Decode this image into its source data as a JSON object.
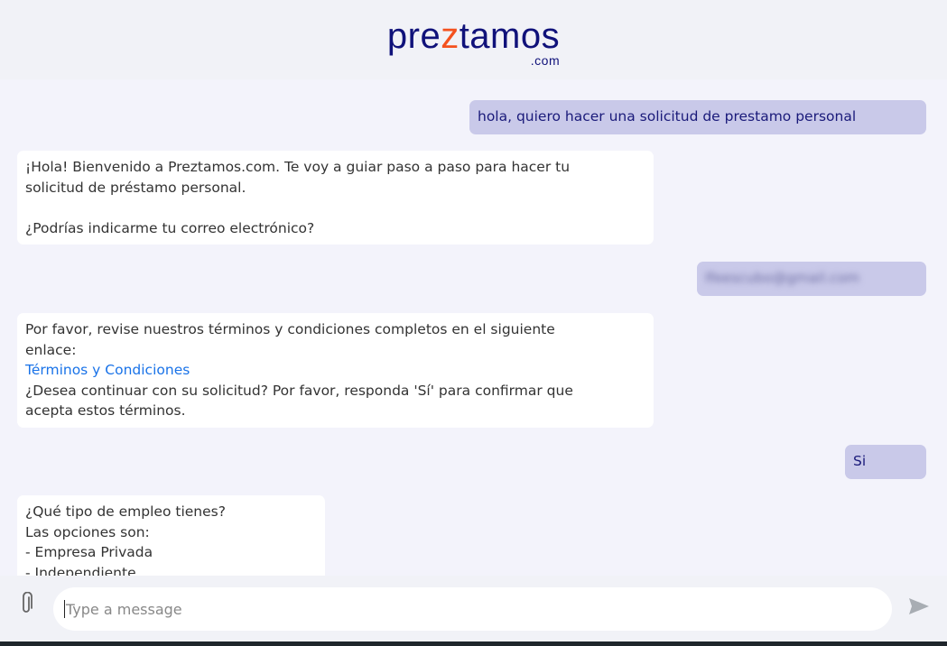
{
  "header": {
    "logo": {
      "pre": "pre",
      "z": "z",
      "post": "tamos",
      "com": ".com"
    }
  },
  "messages": [
    {
      "from": "user",
      "text": "hola, quiero hacer una solicitud de prestamo personal"
    },
    {
      "from": "bot",
      "lines": [
        "¡Hola! Bienvenido a Preztamos.com. Te voy a guiar paso a paso para hacer tu",
        "solicitud de préstamo personal.",
        "",
        "¿Podrías indicarme tu correo electrónico?"
      ]
    },
    {
      "from": "user",
      "text": "lfeescubo@gmail.com",
      "blurred": true
    },
    {
      "from": "bot",
      "lines": [
        "Por favor, revise nuestros términos y condiciones completos en el siguiente",
        "enlace:"
      ],
      "link": "Términos y Condiciones",
      "after": [
        "¿Desea continuar con su solicitud? Por favor, responda 'Sí' para confirmar que",
        "acepta estos términos."
      ]
    },
    {
      "from": "user",
      "text": "Si"
    },
    {
      "from": "bot",
      "lines": [
        "¿Qué tipo de empleo tienes?",
        "Las opciones son:",
        "- Empresa Privada",
        "- Independiente"
      ]
    }
  ],
  "composer": {
    "placeholder": "Type a message",
    "attach_icon": "paperclip-icon",
    "send_icon": "send-icon"
  },
  "colors": {
    "brand": "#10127a",
    "accent": "#f4511e",
    "user_bubble": "#c9c9e9",
    "link": "#1a73e8"
  }
}
